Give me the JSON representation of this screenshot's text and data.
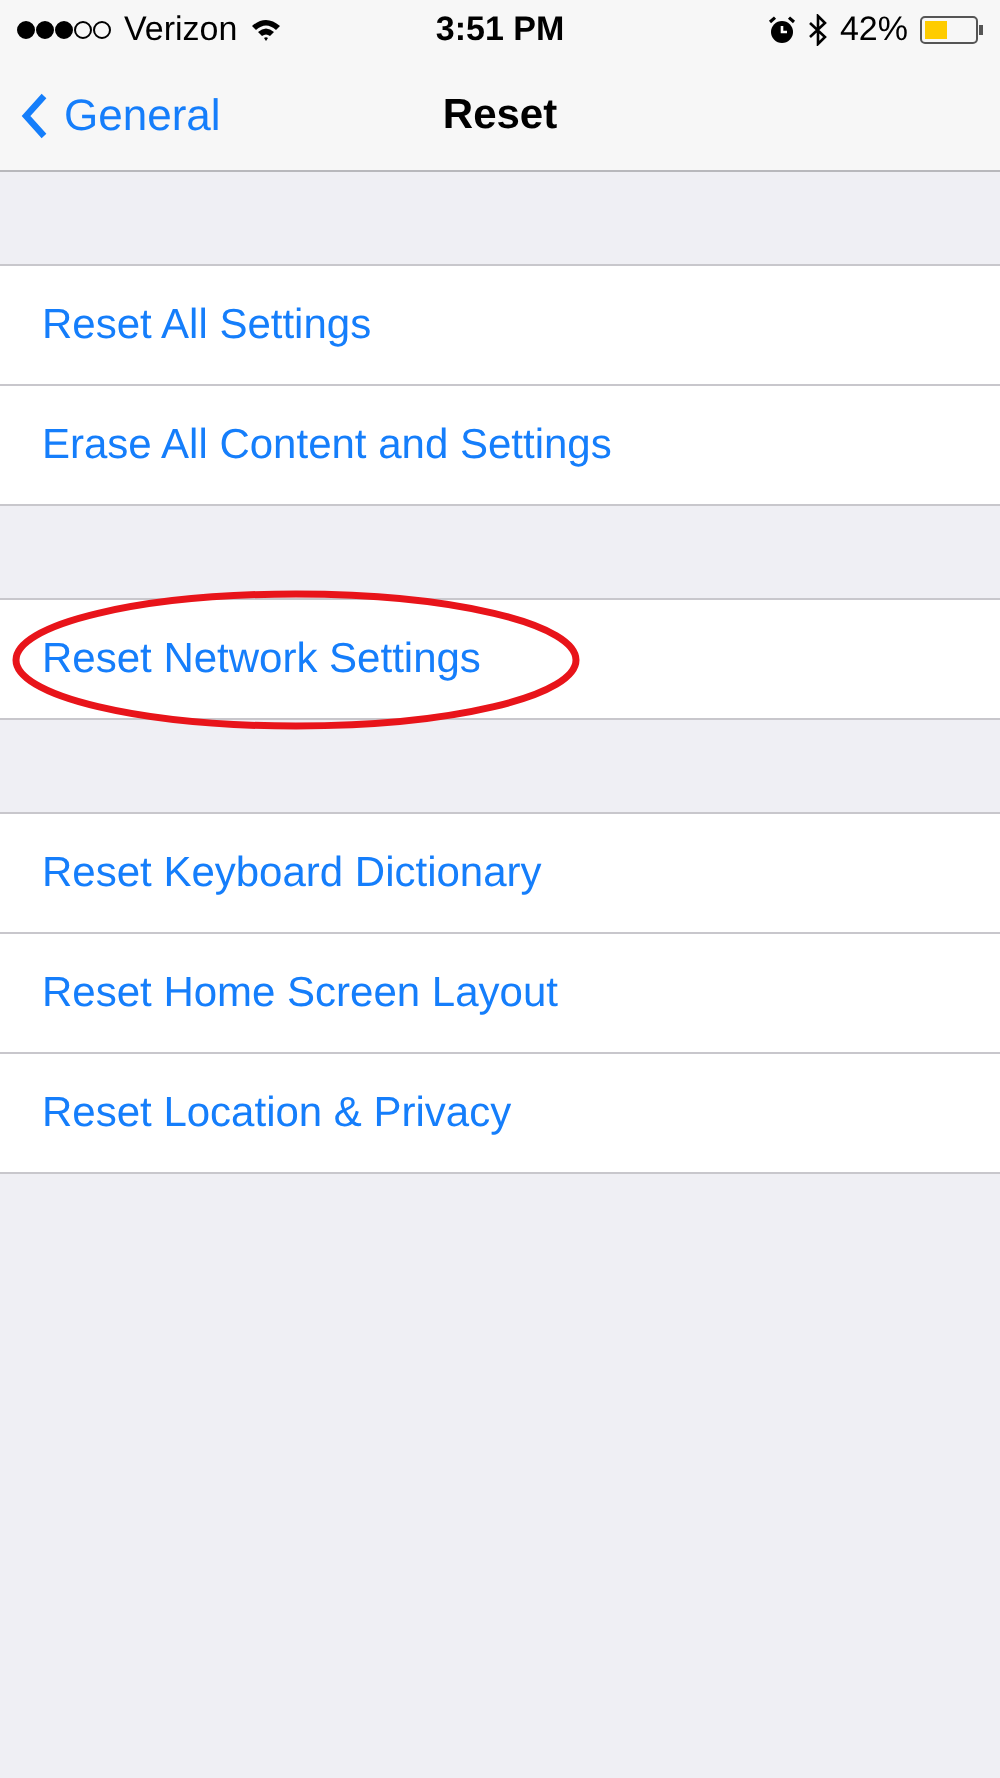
{
  "status_bar": {
    "carrier": "Verizon",
    "time": "3:51 PM",
    "battery": "42%"
  },
  "nav": {
    "back": "General",
    "title": "Reset"
  },
  "groups": [
    {
      "items": [
        {
          "label": "Reset All Settings",
          "circled": false
        },
        {
          "label": "Erase All Content and Settings",
          "circled": false
        }
      ]
    },
    {
      "items": [
        {
          "label": "Reset Network Settings",
          "circled": true
        }
      ]
    },
    {
      "items": [
        {
          "label": "Reset Keyboard Dictionary",
          "circled": false
        },
        {
          "label": "Reset Home Screen Layout",
          "circled": false
        },
        {
          "label": "Reset Location & Privacy",
          "circled": false
        }
      ]
    }
  ]
}
